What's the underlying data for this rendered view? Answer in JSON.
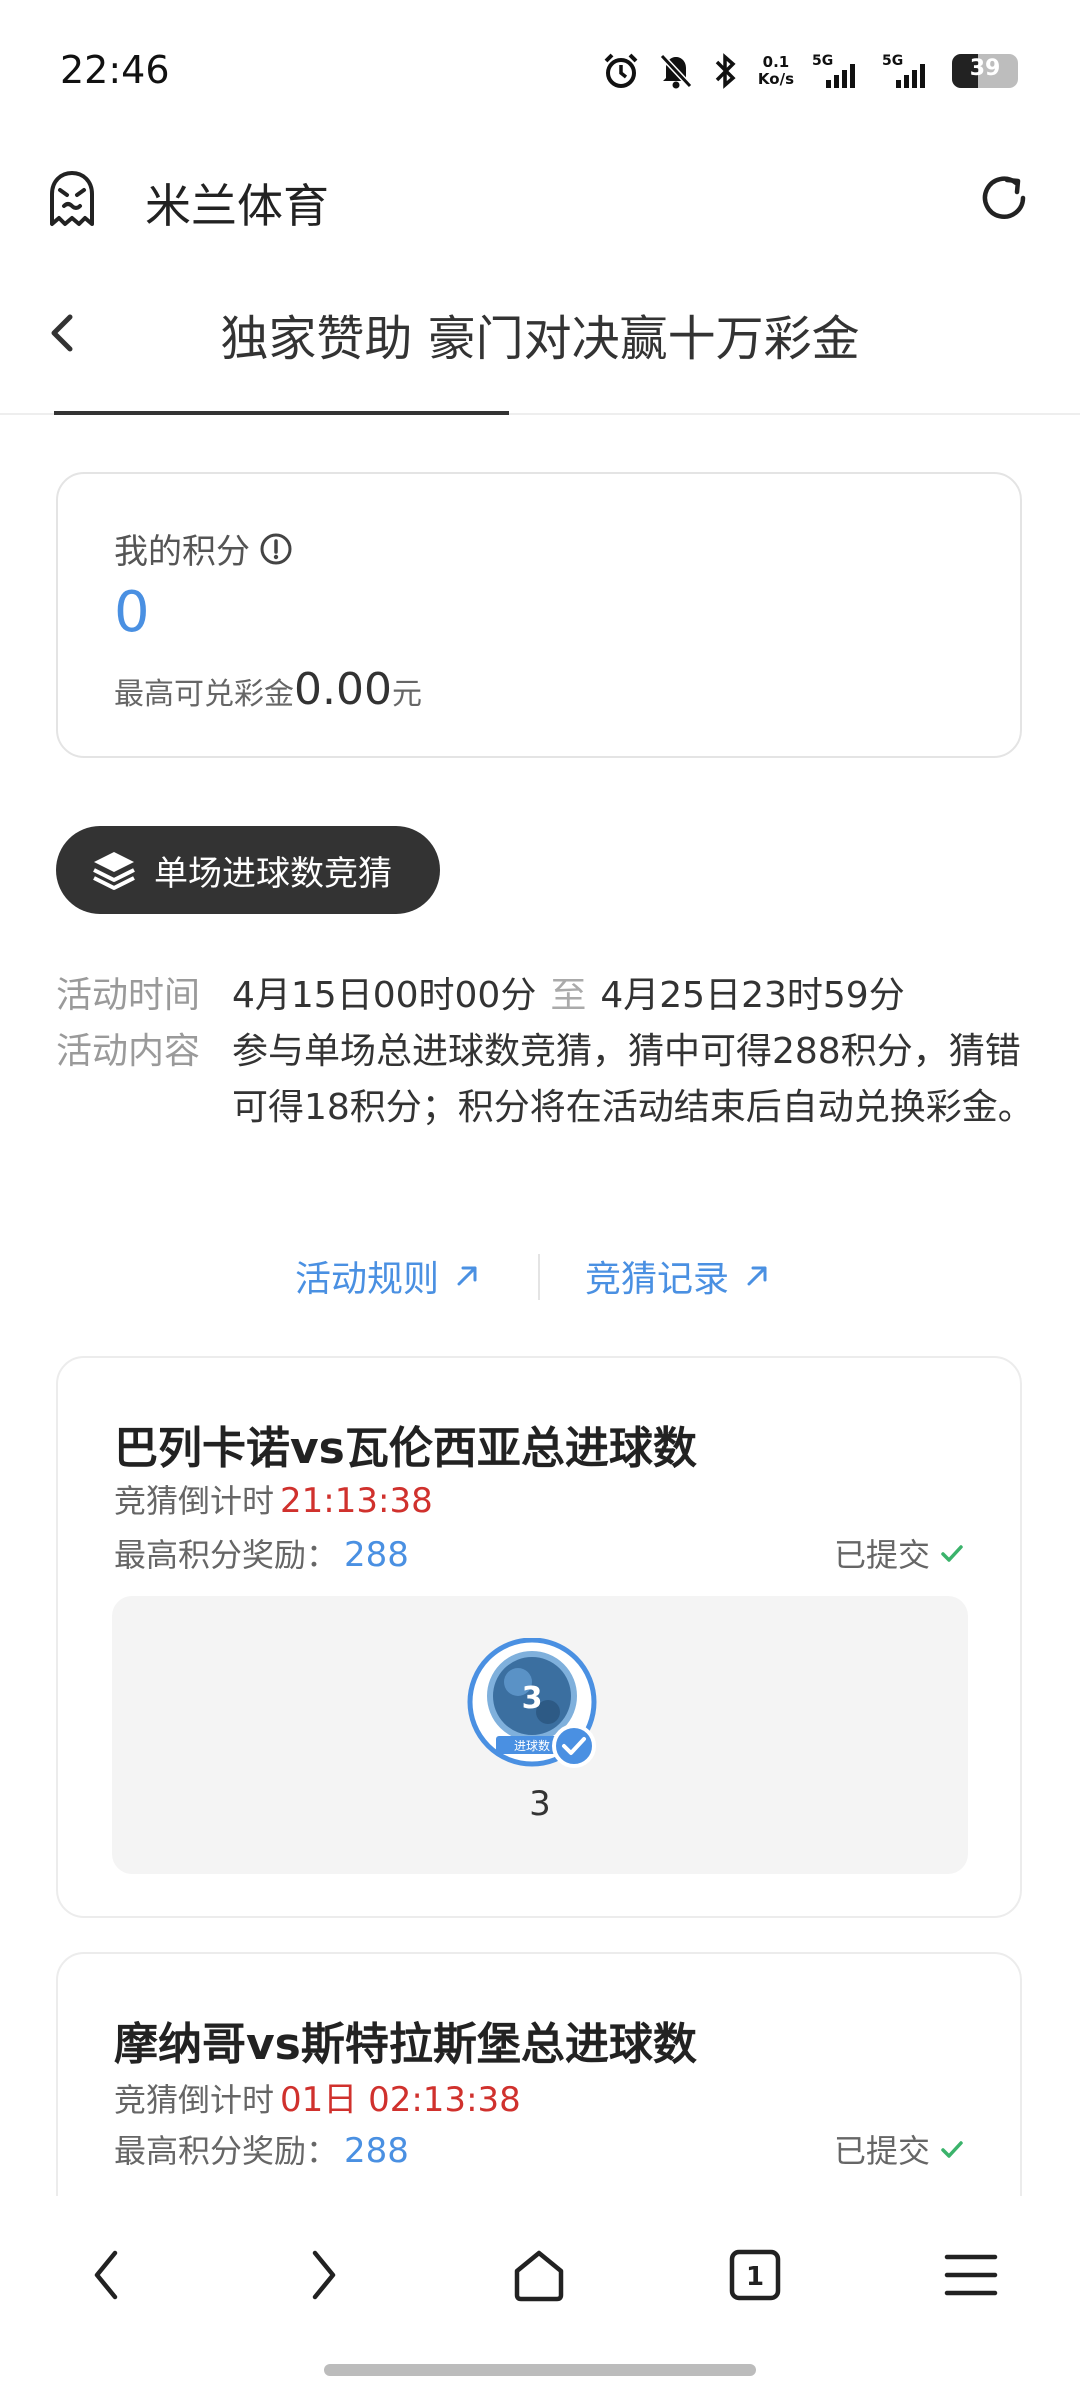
{
  "status_bar": {
    "time": "22:46",
    "net_speed_value": "0.1",
    "net_speed_unit": "Ko/s",
    "signal_1_label": "5G",
    "signal_2_label": "5G",
    "battery": "39",
    "icons": [
      "alarm-icon",
      "mute-icon",
      "bluetooth-icon",
      "signal-icon",
      "signal-icon",
      "battery-icon"
    ]
  },
  "browser": {
    "site_title": "米兰体育",
    "icons": [
      "ghost-icon",
      "refresh-icon"
    ]
  },
  "page": {
    "title": "独家赞助 豪门对决赢十万彩金"
  },
  "points_card": {
    "label": "我的积分",
    "value": "0",
    "exchange_prefix": "最高可兑彩金",
    "exchange_amount": "0.00",
    "exchange_suffix": "元"
  },
  "pill_button": {
    "label": "单场进球数竞猜"
  },
  "activity": {
    "time_key": "活动时间",
    "time_start": "4月15日00时00分",
    "time_sep": "至",
    "time_end": "4月25日23时59分",
    "content_key": "活动内容",
    "content_text": "参与单场总进球数竞猜，猜中可得288积分，猜错可得18积分；积分将在活动结束后自动兑换彩金。"
  },
  "links": {
    "rules": "活动规则",
    "records": "竞猜记录"
  },
  "matches": [
    {
      "title": "巴列卡诺vs瓦伦西亚总进球数",
      "countdown_label": "竞猜倒计时",
      "countdown_value": "21:13:38",
      "reward_label": "最高积分奖励：",
      "reward_value": "288",
      "status": "已提交",
      "badge_number": "3",
      "badge_caption": "进球数",
      "guess_value": "3"
    },
    {
      "title": "摩纳哥vs斯特拉斯堡总进球数",
      "countdown_label": "竞猜倒计时",
      "countdown_value": "01日 02:13:38",
      "reward_label": "最高积分奖励：",
      "reward_value": "288",
      "status": "已提交"
    }
  ],
  "bottom_nav": {
    "tab_count": "1",
    "icons": [
      "back-arrow-icon",
      "forward-arrow-icon",
      "home-icon",
      "tabs-icon",
      "menu-icon"
    ]
  },
  "colors": {
    "accent_blue": "#4a90e2",
    "countdown_red": "#d0312d",
    "success_green": "#3bb36b",
    "dark_pill": "#333333"
  }
}
